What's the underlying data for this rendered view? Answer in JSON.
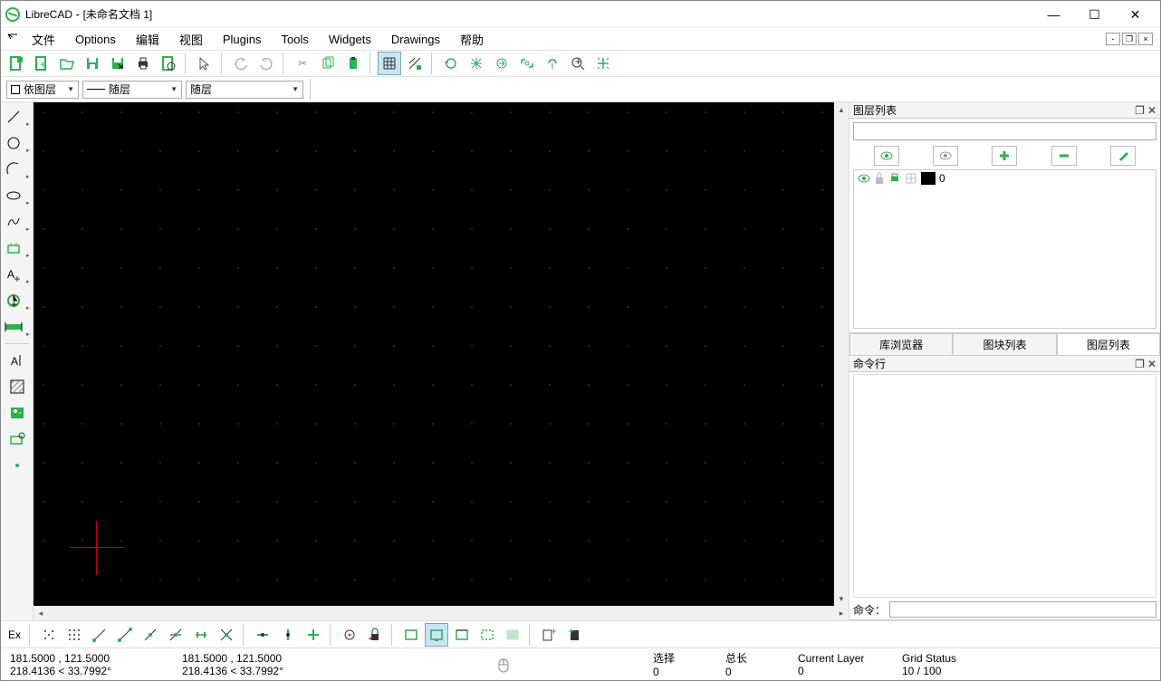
{
  "window": {
    "app": "LibreCAD",
    "doc": "[未命名文档 1]"
  },
  "menu": [
    "文件",
    "Options",
    "编辑",
    "视图",
    "Plugins",
    "Tools",
    "Widgets",
    "Drawings",
    "帮助"
  ],
  "combos": {
    "c1": "依图层",
    "c2": "随层",
    "c3": "随层"
  },
  "rpanel": {
    "layerlist_title": "图层列表",
    "tabs": [
      "库浏览器",
      "图块列表",
      "图层列表"
    ],
    "layer0": "0",
    "cmd_title": "命令行",
    "cmd_label": "命令："
  },
  "status": {
    "coord_abs": "181.5000 , 121.5000",
    "coord_rel": "218.4136 < 33.7992°",
    "coord2_abs": "181.5000 , 121.5000",
    "coord2_rel": "218.4136 < 33.7992°",
    "sel_label": "选择",
    "sel_val": "0",
    "len_label": "总长",
    "len_val": "0",
    "curlayer_label": "Current Layer",
    "curlayer_val": "0",
    "grid_label": "Grid Status",
    "grid_val": "10 / 100"
  },
  "btmEx": "Ex"
}
